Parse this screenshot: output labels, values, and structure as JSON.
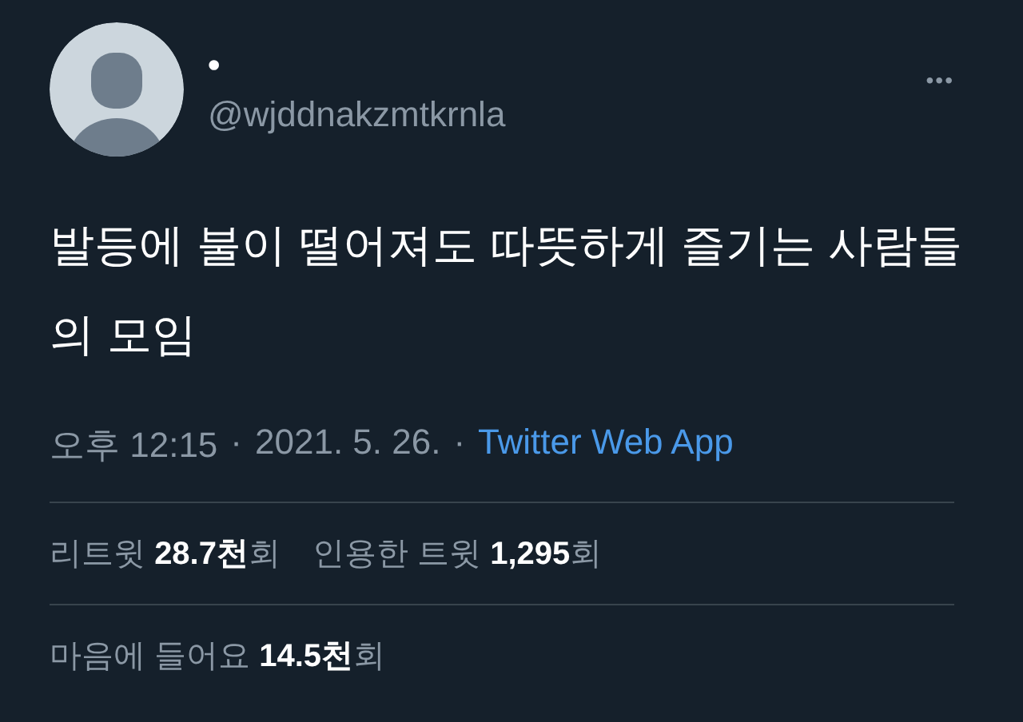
{
  "author": {
    "name": "•",
    "handle": "@wjddnakzmtkrnla"
  },
  "more_button": {
    "label": "•••"
  },
  "tweet": {
    "text": "발등에 불이 떨어져도 따뜻하게 즐기는 사람들의 모임"
  },
  "meta": {
    "time": "오후 12:15",
    "separator_1": "·",
    "date": "2021. 5. 26.",
    "separator_2": "·",
    "source": "Twitter Web App"
  },
  "stats_rows": [
    {
      "items": [
        "리트윗 **28.7천**회",
        "인용한 트윗 **1,295**회"
      ]
    },
    {
      "items": [
        "마음에 들어요 **14.5천**회"
      ]
    }
  ]
}
